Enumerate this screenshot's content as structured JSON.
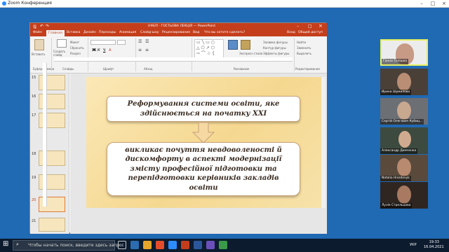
{
  "zoom": {
    "title": "Zoom Конференция"
  },
  "ppt": {
    "title": "НУБіП · ГОСТЬОВА ЛЕКЦІЯ — PowerPoint",
    "tabs": [
      "Файл",
      "Главная",
      "Вставка",
      "Дизайн",
      "Переходы",
      "Анимация",
      "Слайд-шоу",
      "Рецензирование",
      "Вид",
      "Что вы хотите сделать?",
      "Вход",
      "Общий доступ"
    ],
    "active_tab": "Главная",
    "ribbon": {
      "paste": "Вставить",
      "new_slide": "Создать слайд",
      "group_clipboard": "Буфер обмена",
      "group_slides": "Слайды",
      "group_font": "Шрифт",
      "group_paragraph": "Абзац",
      "group_drawing": "Рисование",
      "group_editing": "Редактирование",
      "layout": "Макет",
      "reset": "Сбросить",
      "section": "Раздел",
      "express_styles": "Экспресс-стили",
      "fill": "Заливка фигуры",
      "outline": "Контур фигуры",
      "effects": "Эффекты фигуры",
      "find": "Найти",
      "replace": "Заменить",
      "select": "Выделить"
    },
    "thumbnail_numbers": [
      "15",
      "16",
      "17",
      "18",
      "19",
      "20",
      "21"
    ],
    "selected_slide": "20"
  },
  "slide": {
    "box1_text": "Реформування системи освіти, яке здійснюється на початку XXI",
    "box2_text": "викликає почуття невдоволеності й дискомфорту в аспекті модернізації змісту професійної підготовки та перепідготовки керівників закладів освіти"
  },
  "participants": [
    {
      "name": "Ганна Топішко",
      "active": true
    },
    {
      "name": "Ирина Шумилова"
    },
    {
      "name": "Сергій Олегович Кубиц..."
    },
    {
      "name": "Александр Демченко"
    },
    {
      "name": "Natalia Hnizdovyk"
    },
    {
      "name": "Лулія Стрельцова"
    }
  ],
  "taskbar": {
    "search_placeholder": "Чтобы начать поиск, введите здесь запрос",
    "time": "19:33",
    "date": "16.04.2021",
    "lang": "УКР"
  },
  "colors": {
    "accent": "#c43e1c",
    "slide_bg": "#f5d890",
    "box_border": "#c7a27a"
  }
}
